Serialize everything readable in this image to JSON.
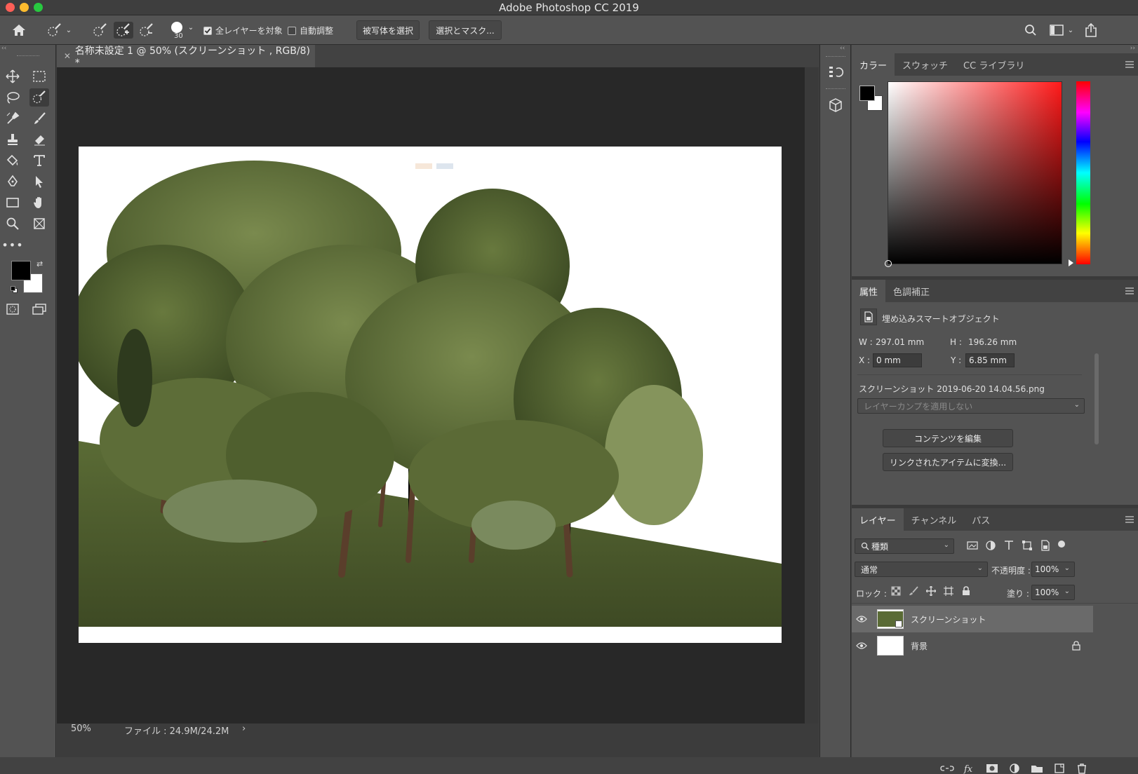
{
  "window": {
    "title": "Adobe Photoshop CC 2019"
  },
  "options_bar": {
    "brush_size": "30",
    "sample_all_layers": {
      "label": "全レイヤーを対象",
      "checked": true
    },
    "auto_enhance": {
      "label": "自動調整",
      "checked": false
    },
    "select_subject_label": "被写体を選択",
    "select_mask_label": "選択とマスク..."
  },
  "document": {
    "tab_title": "名称未設定 1 @ 50% (スクリーンショット , RGB/8) *",
    "zoom": "50%",
    "file_info": "ファイル : 24.9M/24.2M"
  },
  "color_panel": {
    "tabs": [
      "カラー",
      "スウォッチ",
      "CC ライブラリ"
    ],
    "active_tab": 0,
    "foreground": "#000000",
    "background": "#ffffff",
    "hue_base": "#ff1a1a"
  },
  "properties_panel": {
    "tabs": [
      "属性",
      "色調補正"
    ],
    "active_tab": 0,
    "object_type": "埋め込みスマートオブジェクト",
    "w_label": "W :",
    "w_value": "297.01 mm",
    "h_label": "H :",
    "h_value": "196.26 mm",
    "x_label": "X :",
    "x_value": "0 mm",
    "y_label": "Y :",
    "y_value": "6.85 mm",
    "filename": "スクリーンショット 2019-06-20 14.04.56.png",
    "layer_comp_placeholder": "レイヤーカンプを適用しない",
    "edit_contents_label": "コンテンツを編集",
    "convert_linked_label": "リンクされたアイテムに変換..."
  },
  "layers_panel": {
    "tabs": [
      "レイヤー",
      "チャンネル",
      "パス"
    ],
    "active_tab": 0,
    "filter_kind": "種類",
    "blend_mode": "通常",
    "opacity_label": "不透明度 :",
    "opacity_value": "100%",
    "lock_label": "ロック :",
    "fill_label": "塗り :",
    "fill_value": "100%",
    "layers": [
      {
        "name": "スクリーンショット",
        "visible": true,
        "selected": true,
        "locked": false
      },
      {
        "name": "背景",
        "visible": true,
        "selected": false,
        "locked": true
      }
    ]
  }
}
